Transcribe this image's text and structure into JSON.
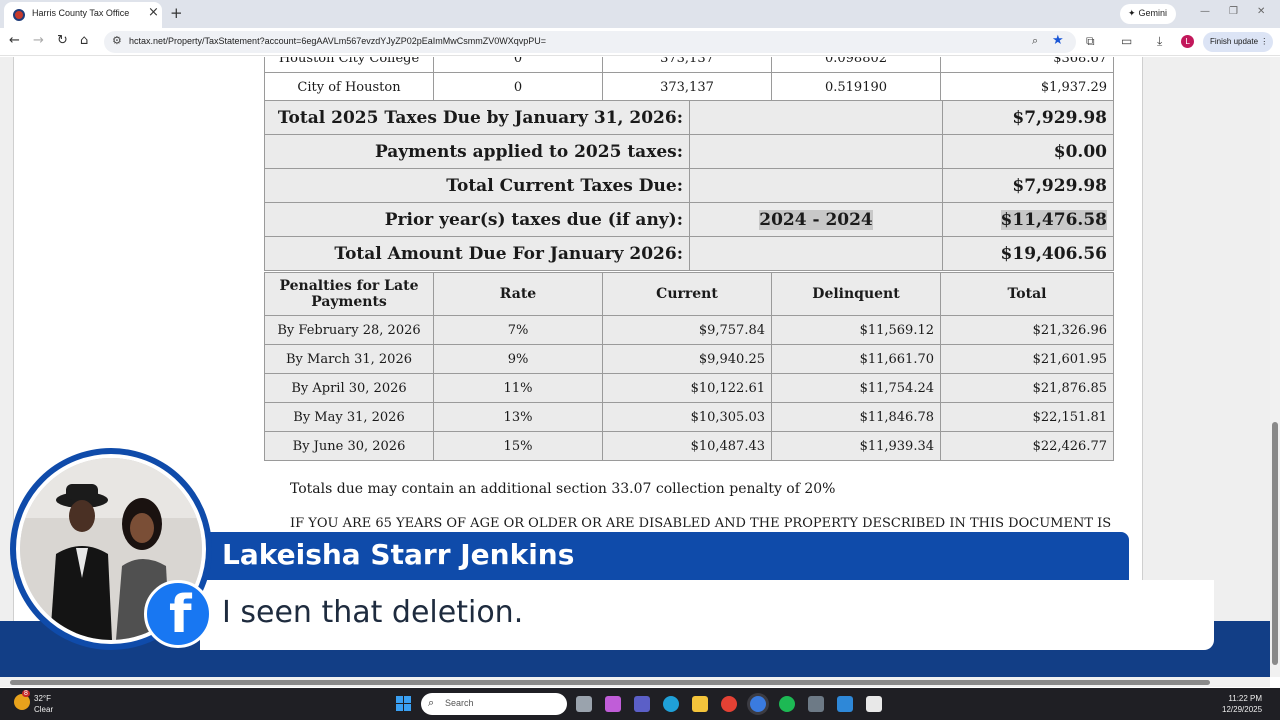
{
  "browser": {
    "tab_title": "Harris County Tax Office",
    "url": "hctax.net/Property/TaxStatement?account=6egAAVLm567evzdYJyZP02pEaImMwCsmmZV0WXqvpPU=",
    "gemini_label": "Gemini",
    "finish_update_label": "Finish update",
    "profile_initial": "L"
  },
  "top_row": {
    "entity": "City of Houston",
    "exemption": "0",
    "taxable_value": "373,137",
    "rate": "0.519190",
    "amount": "$1,937.29"
  },
  "totals": [
    {
      "label": "Total 2025 Taxes Due by January 31, 2026:",
      "middle": "",
      "amount": "$7,929.98"
    },
    {
      "label": "Payments applied to 2025 taxes:",
      "middle": "",
      "amount": "$0.00"
    },
    {
      "label": "Total Current Taxes Due:",
      "middle": "",
      "amount": "$7,929.98"
    },
    {
      "label": "Prior year(s) taxes due (if any):",
      "middle": "2024 - 2024",
      "amount": "$11,476.58"
    },
    {
      "label": "Total Amount Due For January 2026:",
      "middle": "",
      "amount": "$19,406.56"
    }
  ],
  "penalties": {
    "headers": [
      "Penalties for Late Payments",
      "Rate",
      "Current",
      "Delinquent",
      "Total"
    ],
    "rows": [
      [
        "By February 28, 2026",
        "7%",
        "$9,757.84",
        "$11,569.12",
        "$21,326.96"
      ],
      [
        "By March 31, 2026",
        "9%",
        "$9,940.25",
        "$11,661.70",
        "$21,601.95"
      ],
      [
        "By April 30, 2026",
        "11%",
        "$10,122.61",
        "$11,754.24",
        "$21,876.85"
      ],
      [
        "By May 31, 2026",
        "13%",
        "$10,305.03",
        "$11,846.78",
        "$22,151.81"
      ],
      [
        "By June 30, 2026",
        "15%",
        "$10,487.43",
        "$11,939.34",
        "$22,426.77"
      ]
    ]
  },
  "notes": {
    "collection_penalty": "Totals due may contain an additional section 33.07 collection penalty of 20%",
    "age_notice": "IF YOU ARE 65 YEARS OF AGE OR OLDER OR ARE DISABLED AND THE PROPERTY DESCRIBED IN THIS DOCUMENT IS"
  },
  "overlay": {
    "speaker_name": "Lakeisha Starr Jenkins",
    "caption": "I seen that deletion."
  },
  "taskbar": {
    "temperature": "32°F",
    "weather": "Clear",
    "weather_badge": "8",
    "search_placeholder": "Search",
    "time": "11:22 PM",
    "date": "12/29/2025"
  },
  "colors": {
    "name_bar": "#0f4baa",
    "bottom_band": "#123e86",
    "facebook": "#1877f2"
  }
}
